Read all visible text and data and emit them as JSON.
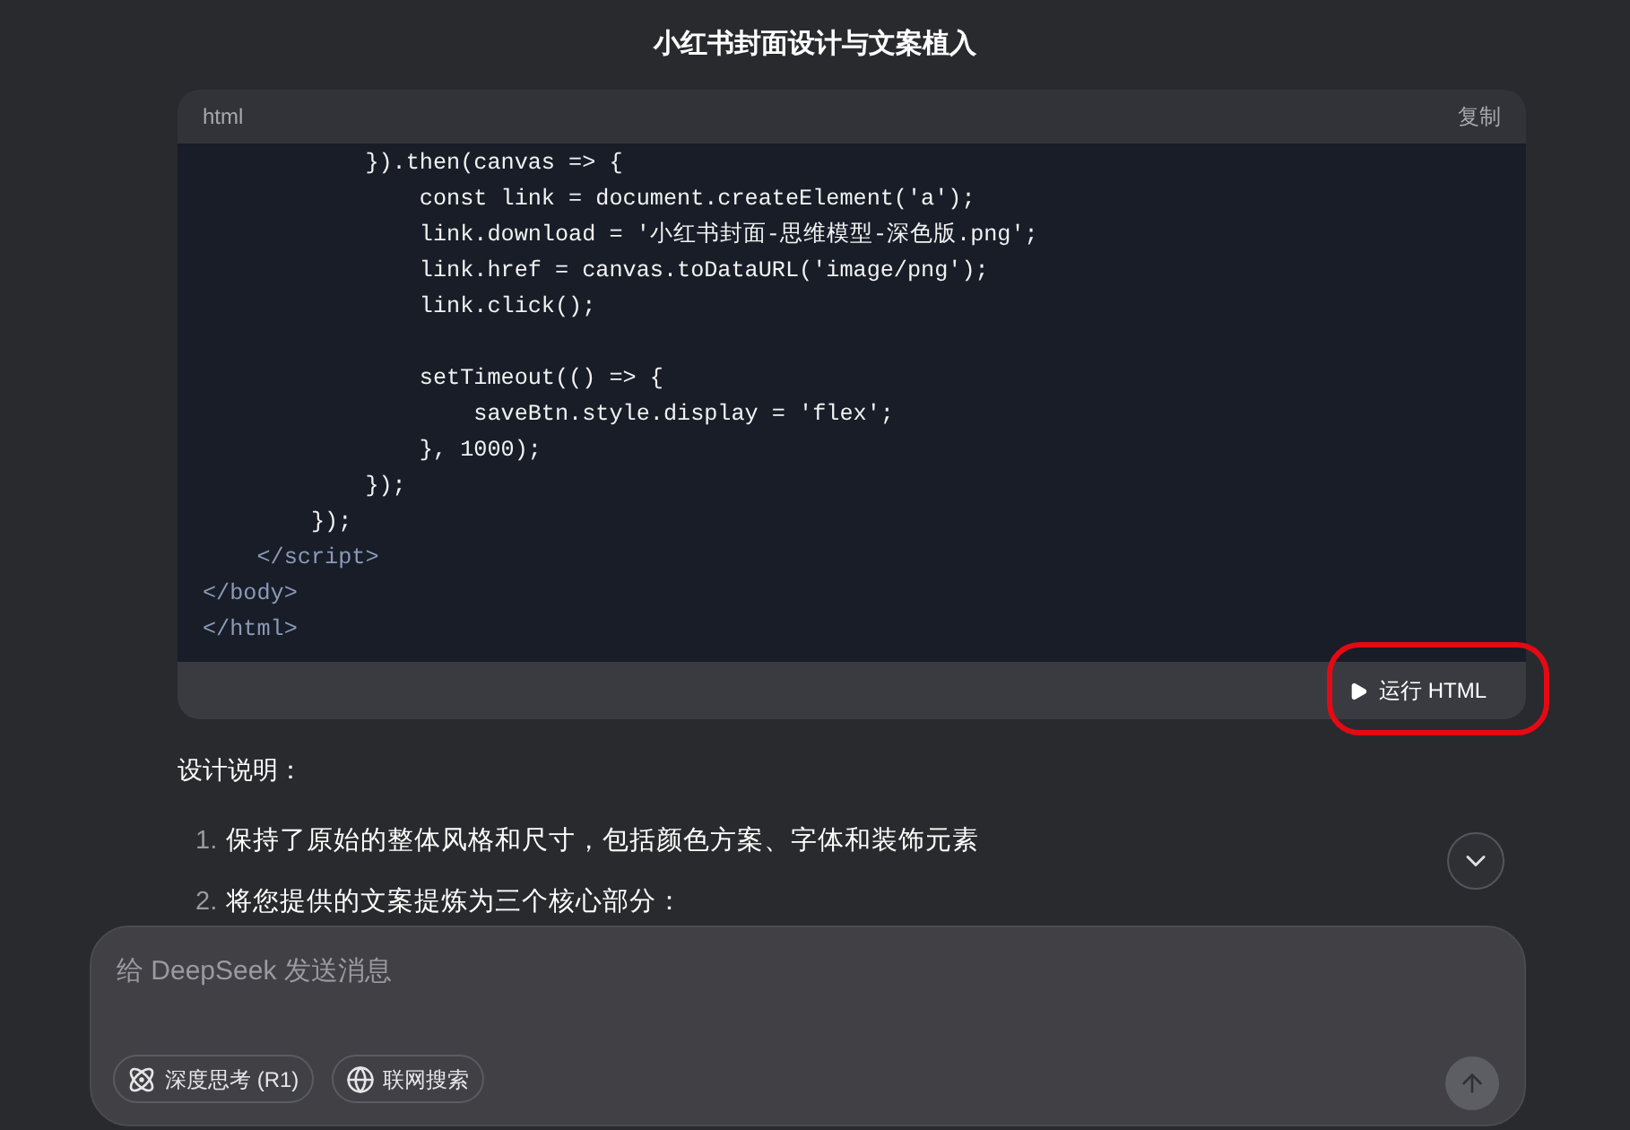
{
  "title": "小红书封面设计与文案植入",
  "code_block": {
    "language": "html",
    "copy_label": "复制",
    "lines": [
      {
        "kind": "code",
        "text": "            }).then(canvas => {"
      },
      {
        "kind": "code",
        "text": "                const link = document.createElement('a');"
      },
      {
        "kind": "code",
        "text": "                link.download = '小红书封面-思维模型-深色版.png';"
      },
      {
        "kind": "code",
        "text": "                link.href = canvas.toDataURL('image/png');"
      },
      {
        "kind": "code",
        "text": "                link.click();"
      },
      {
        "kind": "blank"
      },
      {
        "kind": "code",
        "text": "                setTimeout(() => {"
      },
      {
        "kind": "code",
        "text": "                    saveBtn.style.display = 'flex';"
      },
      {
        "kind": "code",
        "text": "                }, 1000);"
      },
      {
        "kind": "code",
        "text": "            });"
      },
      {
        "kind": "code",
        "text": "        });"
      },
      {
        "kind": "tag",
        "text": "    </script>"
      },
      {
        "kind": "tag",
        "text": "</body>"
      },
      {
        "kind": "tag",
        "text": "</html>"
      }
    ],
    "run_button": {
      "label": "运行 HTML",
      "highlighted": true
    }
  },
  "answer": {
    "heading": "设计说明：",
    "items": [
      {
        "number": "1.",
        "text": "保持了原始的整体风格和尺寸，包括颜色方案、字体和装饰元素"
      },
      {
        "number": "2.",
        "text": "将您提供的文案提炼为三个核心部分："
      }
    ]
  },
  "composer": {
    "placeholder": "给 DeepSeek 发送消息",
    "toggles": [
      {
        "kind": "think",
        "label": "深度思考 (R1)",
        "selected": false
      },
      {
        "kind": "search",
        "label": "联网搜索",
        "selected": false
      }
    ]
  }
}
